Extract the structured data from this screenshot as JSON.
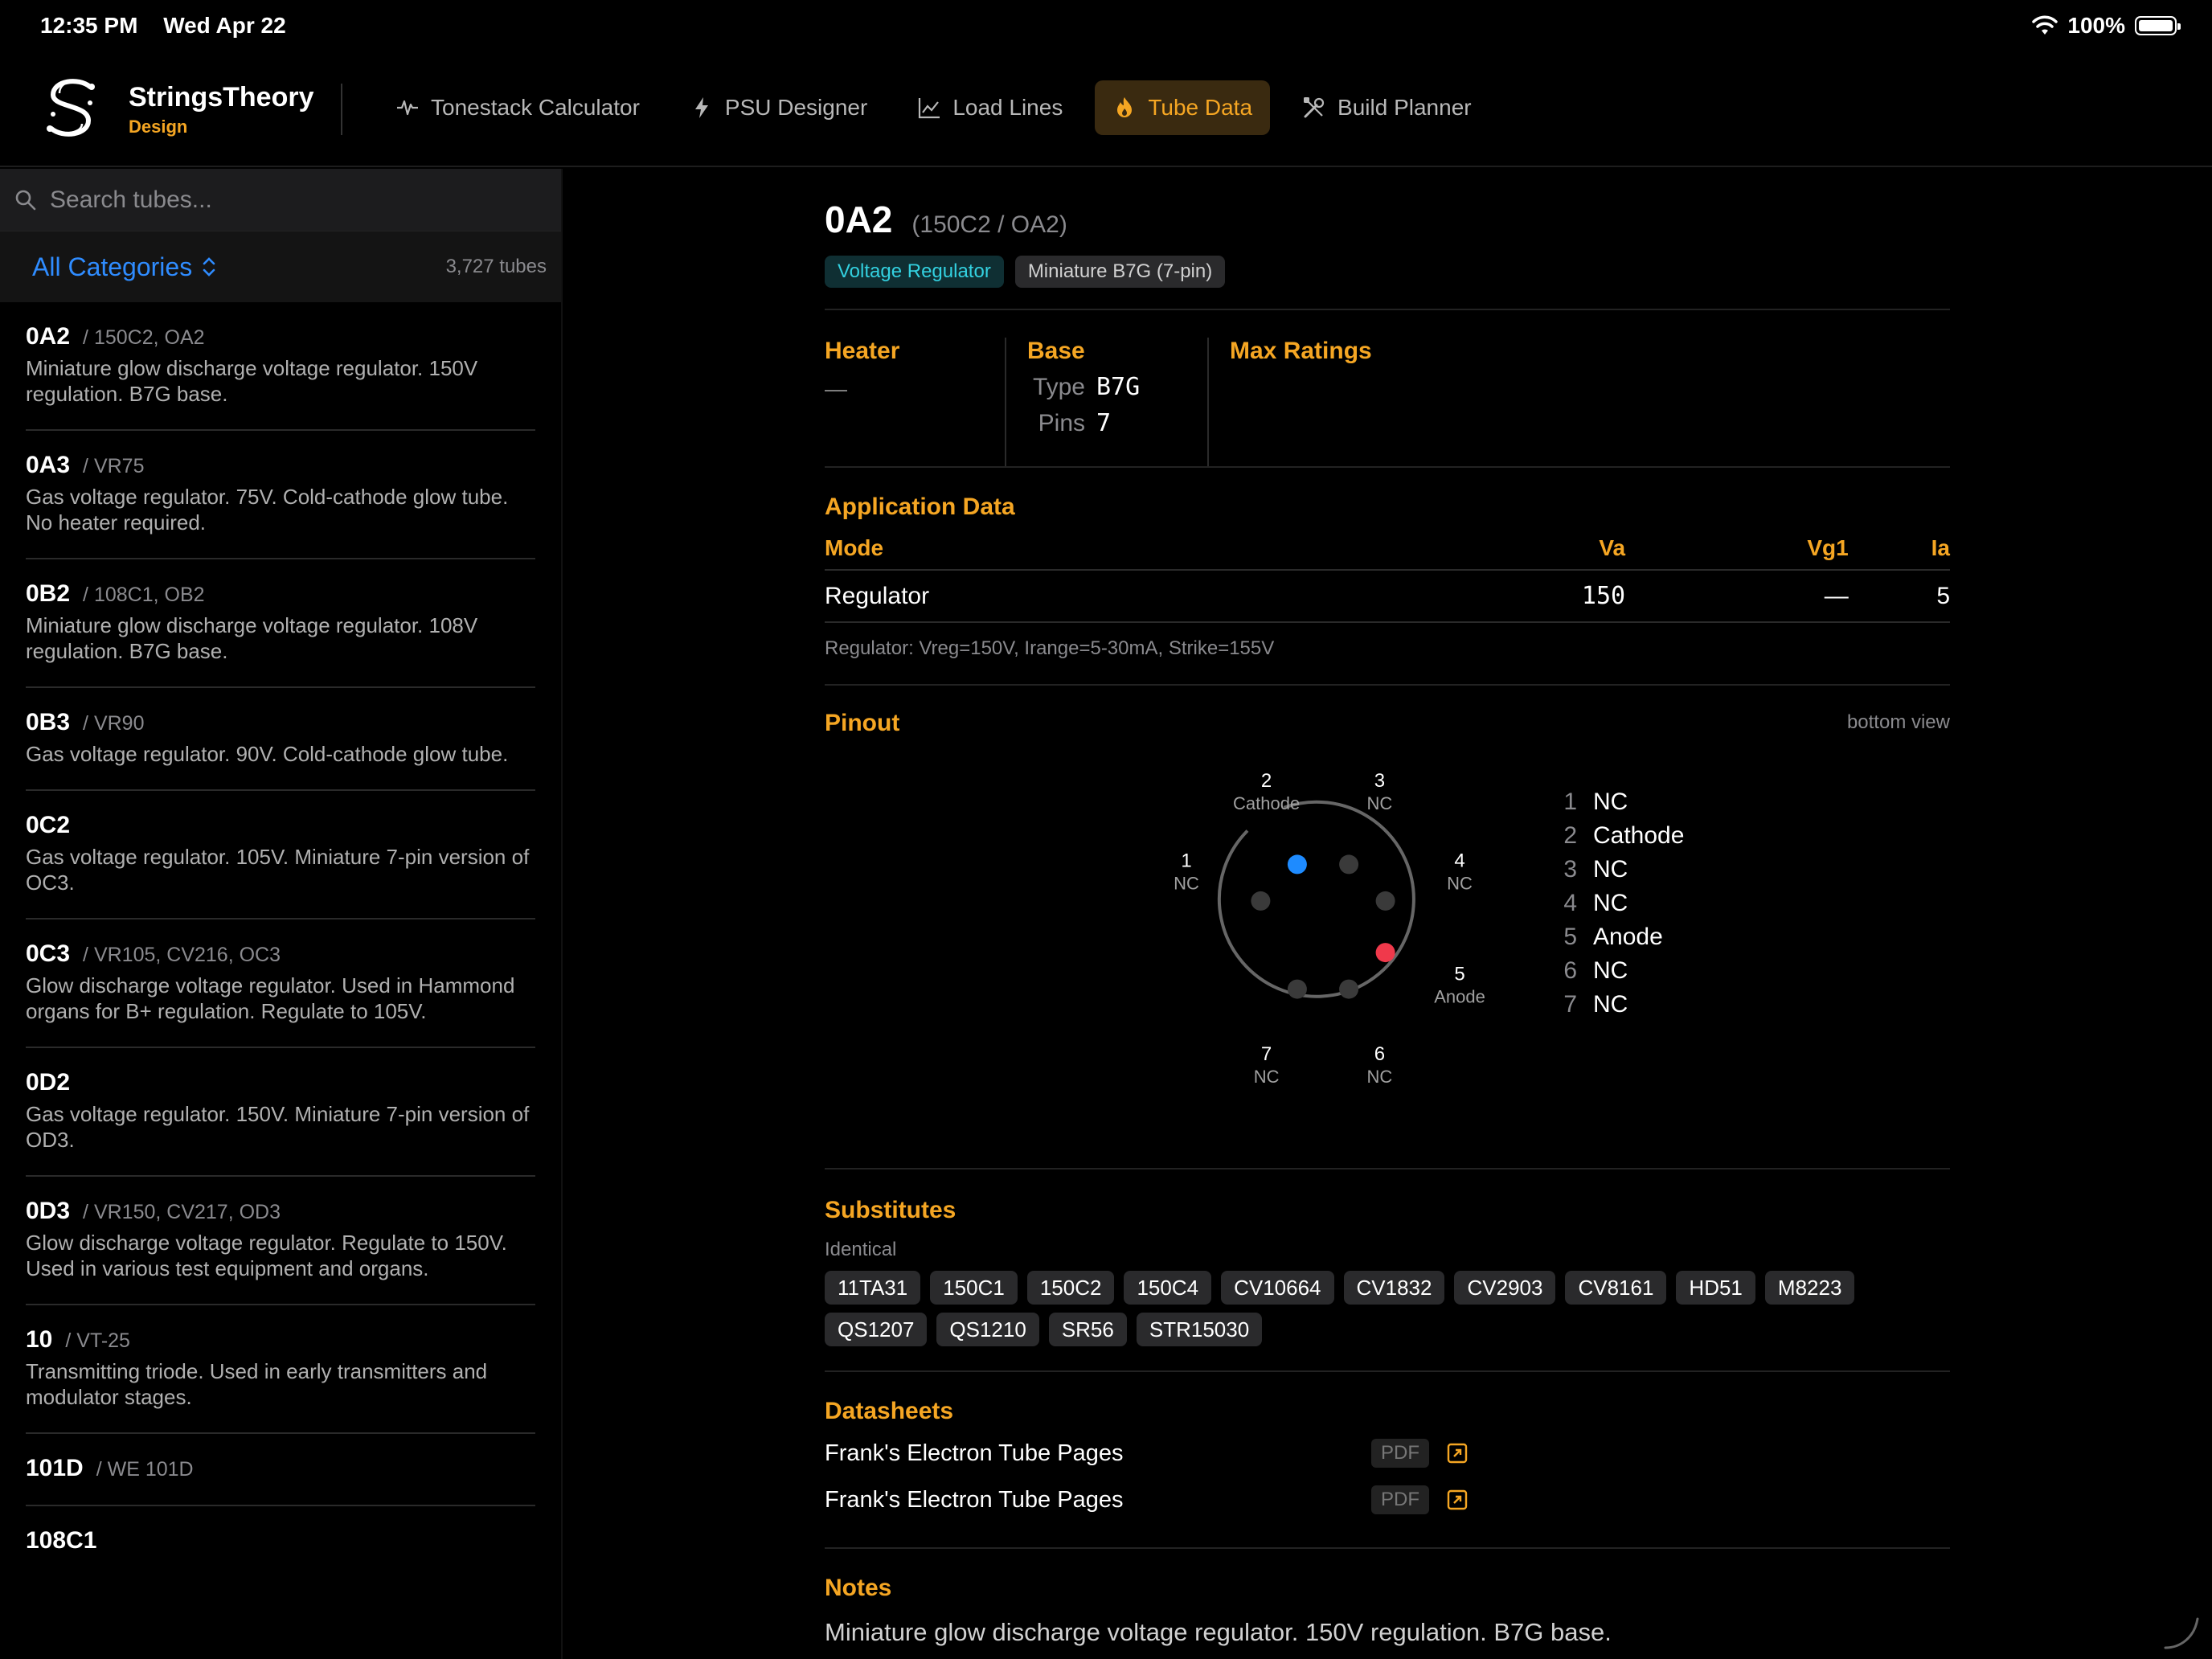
{
  "status": {
    "time": "12:35 PM",
    "date": "Wed Apr 22",
    "battery": "100%"
  },
  "brand": {
    "name": "StringsTheory",
    "sub": "Design"
  },
  "nav": [
    {
      "label": "Tonestack Calculator",
      "icon": "waveform-icon",
      "active": false
    },
    {
      "label": "PSU Designer",
      "icon": "bolt-icon",
      "active": false
    },
    {
      "label": "Load Lines",
      "icon": "line-chart-icon",
      "active": false
    },
    {
      "label": "Tube Data",
      "icon": "flame-icon",
      "active": true
    },
    {
      "label": "Build Planner",
      "icon": "tools-icon",
      "active": false
    }
  ],
  "sidebar": {
    "search_placeholder": "Search tubes...",
    "category": "All Categories",
    "count": "3,727 tubes",
    "tubes": [
      {
        "name": "0A2",
        "alias": "/ 150C2, OA2",
        "desc": "Miniature glow discharge voltage regulator. 150V regulation. B7G base."
      },
      {
        "name": "0A3",
        "alias": "/ VR75",
        "desc": "Gas voltage regulator. 75V. Cold-cathode glow tube. No heater required."
      },
      {
        "name": "0B2",
        "alias": "/ 108C1, OB2",
        "desc": "Miniature glow discharge voltage regulator. 108V regulation. B7G base."
      },
      {
        "name": "0B3",
        "alias": "/ VR90",
        "desc": "Gas voltage regulator. 90V. Cold-cathode glow tube."
      },
      {
        "name": "0C2",
        "alias": "",
        "desc": "Gas voltage regulator. 105V. Miniature 7-pin version of OC3."
      },
      {
        "name": "0C3",
        "alias": "/ VR105, CV216, OC3",
        "desc": "Glow discharge voltage regulator. Used in Hammond organs for B+ regulation. Regulate to 105V."
      },
      {
        "name": "0D2",
        "alias": "",
        "desc": "Gas voltage regulator. 150V. Miniature 7-pin version of OD3."
      },
      {
        "name": "0D3",
        "alias": "/ VR150, CV217, OD3",
        "desc": "Glow discharge voltage regulator. Regulate to 150V. Used in various test equipment and organs."
      },
      {
        "name": "10",
        "alias": "/ VT-25",
        "desc": "Transmitting triode. Used in early transmitters and modulator stages."
      },
      {
        "name": "101D",
        "alias": "/ WE 101D",
        "desc": ""
      },
      {
        "name": "108C1",
        "alias": "",
        "desc": ""
      }
    ]
  },
  "detail": {
    "title": "0A2",
    "alias": "(150C2 / OA2)",
    "tags": [
      "Voltage Regulator",
      "Miniature B7G (7-pin)"
    ],
    "heater": {
      "title": "Heater",
      "value": "—"
    },
    "base": {
      "title": "Base",
      "type_label": "Type",
      "type": "B7G",
      "pins_label": "Pins",
      "pins": "7"
    },
    "max_ratings": {
      "title": "Max Ratings"
    },
    "application": {
      "title": "Application Data",
      "headers": [
        "Mode",
        "Va",
        "Vg1",
        "Ia"
      ],
      "rows": [
        [
          "Regulator",
          "150",
          "—",
          "5"
        ]
      ],
      "note": "Regulator: Vreg=150V, Irange=5-30mA, Strike=155V"
    },
    "pinout": {
      "title": "Pinout",
      "view": "bottom view",
      "pins": [
        {
          "n": "1",
          "name": "NC"
        },
        {
          "n": "2",
          "name": "Cathode"
        },
        {
          "n": "3",
          "name": "NC"
        },
        {
          "n": "4",
          "name": "NC"
        },
        {
          "n": "5",
          "name": "Anode"
        },
        {
          "n": "6",
          "name": "NC"
        },
        {
          "n": "7",
          "name": "NC"
        }
      ],
      "colors": {
        "cathode": "#1e8bff",
        "anode": "#f0394b",
        "nc": "#3a3a3a"
      }
    },
    "substitutes": {
      "title": "Substitutes",
      "label": "Identical",
      "items": [
        "11TA31",
        "150C1",
        "150C2",
        "150C4",
        "CV10664",
        "CV1832",
        "CV2903",
        "CV8161",
        "HD51",
        "M8223",
        "QS1207",
        "QS1210",
        "SR56",
        "STR15030"
      ]
    },
    "datasheets": {
      "title": "Datasheets",
      "items": [
        {
          "name": "Frank's Electron Tube Pages",
          "badge": "PDF"
        },
        {
          "name": "Frank's Electron Tube Pages",
          "badge": "PDF"
        }
      ]
    },
    "notes": {
      "title": "Notes",
      "text": "Miniature glow discharge voltage regulator. 150V regulation. B7G base."
    }
  },
  "colors": {
    "accent": "#f5a623",
    "link": "#2f8cff",
    "teal": "#33d1e0"
  }
}
